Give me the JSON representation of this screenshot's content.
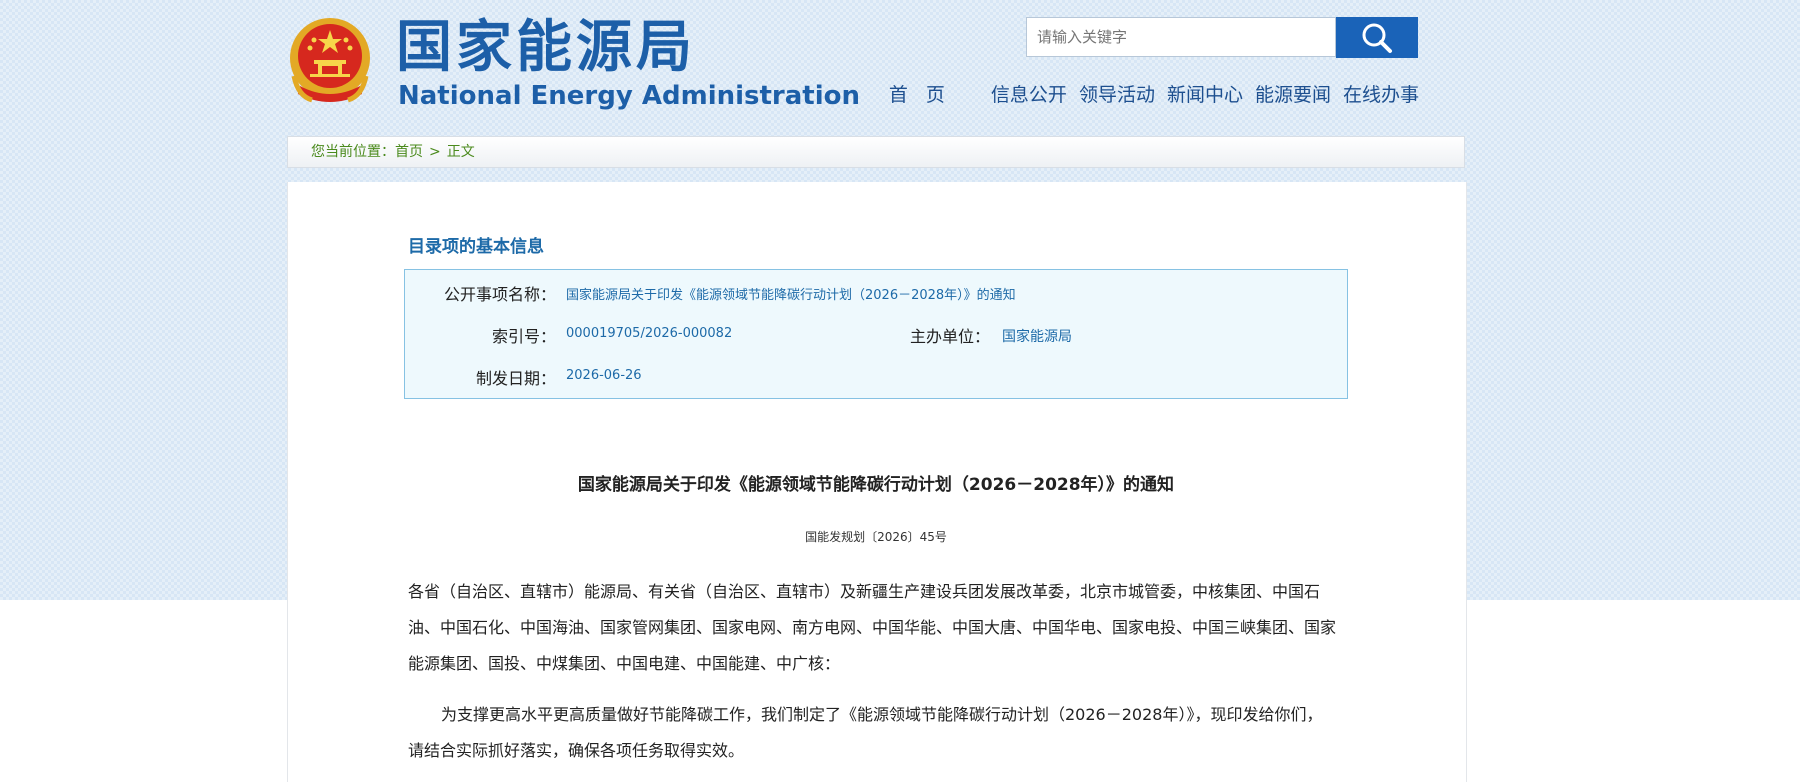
{
  "header": {
    "title_cn": "国家能源局",
    "title_en": "National Energy Administration",
    "search_placeholder": "请输入关键字",
    "emblem_icon": "national-emblem-icon",
    "search_icon": "search-icon"
  },
  "nav": {
    "items": [
      {
        "label": "首 页"
      },
      {
        "label": "信息公开"
      },
      {
        "label": "领导活动"
      },
      {
        "label": "新闻中心"
      },
      {
        "label": "能源要闻"
      },
      {
        "label": "在线办事"
      }
    ]
  },
  "breadcrumb": {
    "prefix": "您当前位置：",
    "home": "首页",
    "separator": ">",
    "current": "正文"
  },
  "info": {
    "heading": "目录项的基本信息",
    "name_label": "公开事项名称：",
    "name_value": "国家能源局关于印发《能源领域节能降碳行动计划（2026－2028年）》的通知",
    "index_label": "索引号：",
    "index_value": "000019705/2026-000082",
    "org_label": "主办单位：",
    "org_value": "国家能源局",
    "date_label": "制发日期：",
    "date_value": "2026-06-26"
  },
  "document": {
    "title": "国家能源局关于印发《能源领域节能降碳行动计划（2026－2028年）》的通知",
    "number": "国能发规划〔2026〕45号",
    "recipients": "各省（自治区、直辖市）能源局、有关省（自治区、直辖市）及新疆生产建设兵团发展改革委，北京市城管委，中核集团、中国石油、中国石化、中国海油、国家管网集团、国家电网、南方电网、中国华能、中国大唐、中国华电、国家电投、中国三峡集团、国家能源集团、国投、中煤集团、中国电建、中国能建、中广核：",
    "body": "为支撑更高水平更高质量做好节能降碳工作，我们制定了《能源领域节能降碳行动计划（2026－2028年）》，现印发给你们，请结合实际抓好落实，确保各项任务取得实效。"
  },
  "colors": {
    "brand_blue": "#1d5fa8",
    "search_button": "#1a63b8",
    "breadcrumb_green": "#4a8a1c",
    "info_box_bg": "#eef9fd",
    "info_box_border": "#86c2e3"
  }
}
